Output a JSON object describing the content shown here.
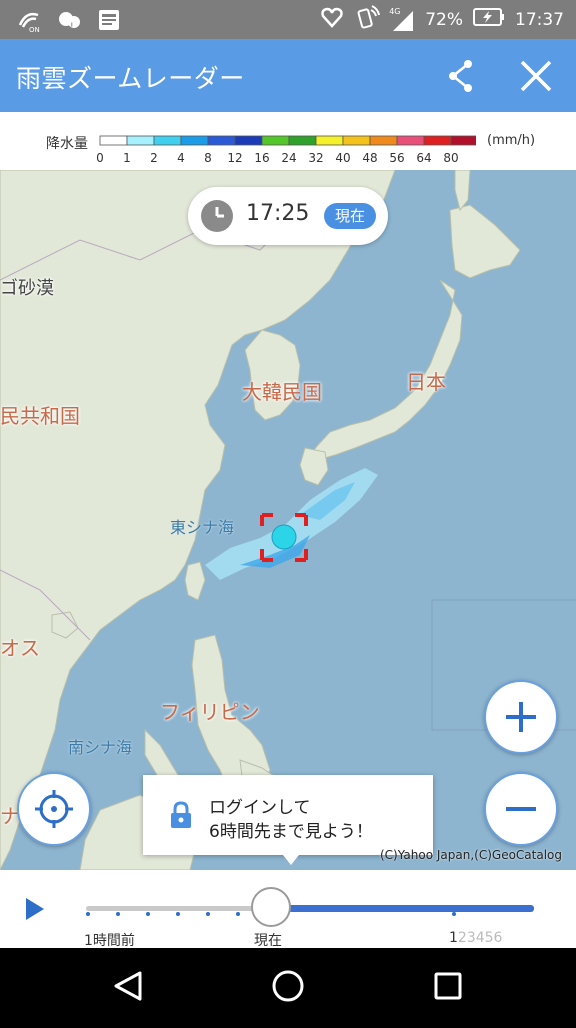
{
  "status_bar": {
    "battery": "72%",
    "time": "17:37",
    "network": "4G"
  },
  "app_bar": {
    "title": "雨雲ズームレーダー",
    "share_icon": "share-icon",
    "close_icon": "close-icon"
  },
  "legend": {
    "label": "降水量",
    "unit": "(mm/h)",
    "ticks": [
      "0",
      "1",
      "2",
      "4",
      "8",
      "12",
      "16",
      "24",
      "32",
      "40",
      "48",
      "56",
      "64",
      "80"
    ],
    "colors": [
      "#ffffff",
      "#a6f0ff",
      "#3fd0f0",
      "#1a9ce8",
      "#2b5ad8",
      "#1c3bb8",
      "#53c72a",
      "#2ea22a",
      "#f4f02a",
      "#f5c21c",
      "#f08a1c",
      "#e8507a",
      "#e02020",
      "#b0102a"
    ]
  },
  "map": {
    "labels": {
      "mongolia_desert": "ゴ砂漠",
      "korea": "大韓民国",
      "japan": "日本",
      "china": "民共和国",
      "east_china_sea": "東シナ海",
      "laos": "オス",
      "philippines": "フィリピン",
      "south_china_sea": "南シナ海",
      "vietnam": "ナ"
    },
    "copyright": "(C)Yahoo Japan,(C)GeoCatalog"
  },
  "time_badge": {
    "time": "17:25",
    "now_label": "現在"
  },
  "login_prompt": {
    "line1": "ログインして",
    "line2": "6時間先まで見よう！"
  },
  "timeline": {
    "past_label": "1時間前",
    "now_label": "現在",
    "future_first": "1",
    "future_rest": "23456"
  }
}
